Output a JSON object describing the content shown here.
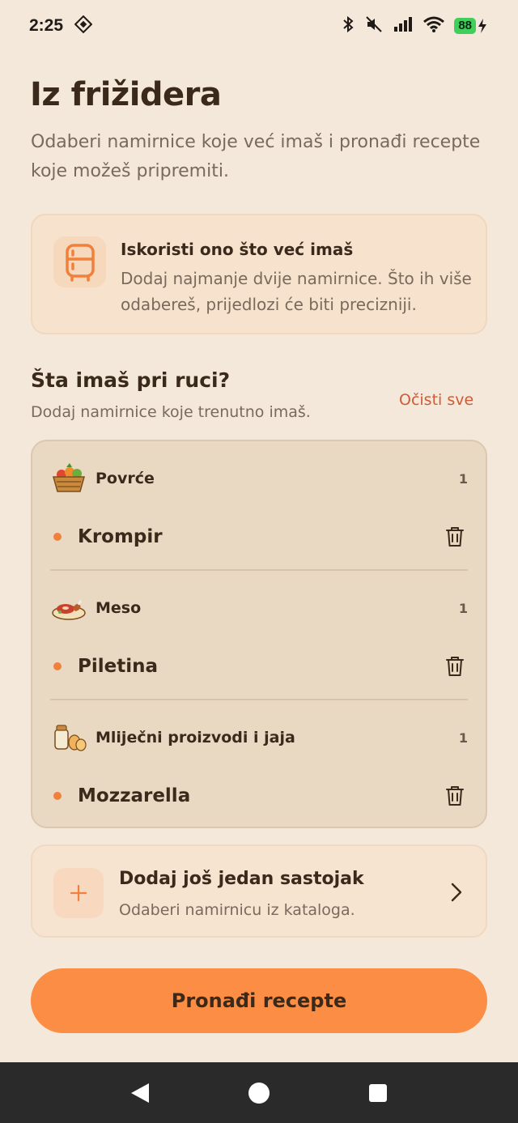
{
  "status_bar": {
    "time": "2:25",
    "battery": "88"
  },
  "header": {
    "title": "Iz frižidera",
    "subtitle": "Odaberi namirnice koje već imaš i pronađi recepte koje možeš pripremiti."
  },
  "info_card": {
    "icon": "fridge-icon",
    "title": "Iskoristi ono što već imaš",
    "text": "Dodaj najmanje dvije namirnice. Što ih više odabereš, prijedlozi će biti precizniji."
  },
  "pantry": {
    "title": "Šta imaš pri ruci?",
    "subtitle": "Dodaj namirnice koje trenutno imaš.",
    "clear_label": "Očisti sve",
    "groups": [
      {
        "name": "Povrće",
        "icon": "vegetable-basket-icon",
        "count": "1",
        "items": [
          {
            "name": "Krompir"
          }
        ]
      },
      {
        "name": "Meso",
        "icon": "meat-plate-icon",
        "count": "1",
        "items": [
          {
            "name": "Piletina"
          }
        ]
      },
      {
        "name": "Mliječni proizvodi i jaja",
        "icon": "dairy-eggs-icon",
        "count": "1",
        "items": [
          {
            "name": "Mozzarella"
          }
        ]
      }
    ]
  },
  "add_card": {
    "title": "Dodaj još jedan sastojak",
    "subtitle": "Odaberi namirnicu iz kataloga."
  },
  "primary_button": {
    "label": "Pronađi recepte"
  },
  "colors": {
    "background": "#f4e8da",
    "accent": "#fc8d44",
    "danger_text": "#d05a36",
    "text_primary": "#3b2a1c",
    "text_secondary": "#7a6a5c"
  }
}
